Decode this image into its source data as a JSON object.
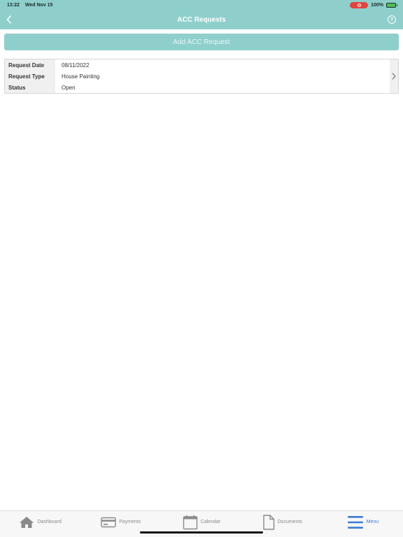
{
  "status_bar": {
    "time": "13:22",
    "date": "Wed Nov 15",
    "battery": "100%"
  },
  "nav": {
    "title": "ACC Requests",
    "help_label": "?"
  },
  "add_button_label": "Add ACC Request",
  "request": {
    "rows": [
      {
        "label": "Request Date",
        "value": "08/11/2022"
      },
      {
        "label": "Request Type",
        "value": "House Painting"
      },
      {
        "label": "Status",
        "value": "Open"
      }
    ]
  },
  "tabs": [
    {
      "label": "Dashboard",
      "icon": "home-icon"
    },
    {
      "label": "Payments",
      "icon": "credit-card-icon"
    },
    {
      "label": "Calendar",
      "icon": "calendar-icon"
    },
    {
      "label": "Documents",
      "icon": "document-icon"
    },
    {
      "label": "Menu",
      "icon": "menu-icon",
      "active": true
    }
  ],
  "colors": {
    "brand": "#8ecfcc",
    "active_tab": "#3a7bd5",
    "recording": "#e0453f"
  }
}
